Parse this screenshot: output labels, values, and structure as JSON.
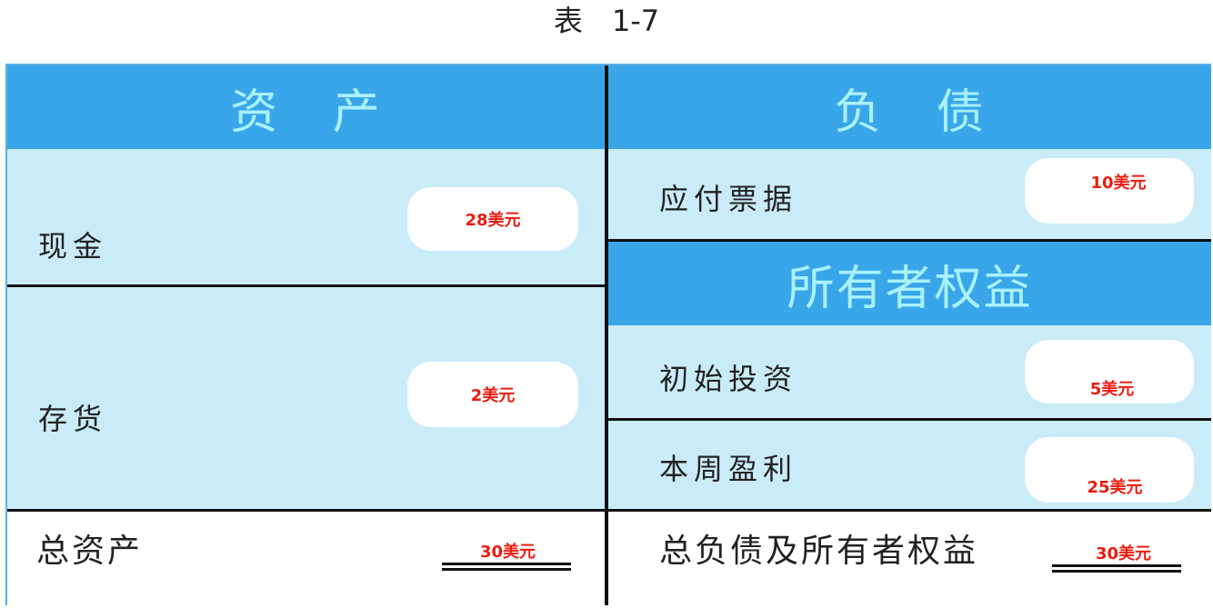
{
  "caption": "表　1-7",
  "assets": {
    "header": "资 产",
    "rows": [
      {
        "label": "现金",
        "amount": "28美元"
      },
      {
        "label": "存货",
        "amount": "2美元"
      }
    ],
    "total_label": "总资产",
    "total_amount": "30美元"
  },
  "liabilities": {
    "header": "负 债",
    "rows": [
      {
        "label": "应付票据",
        "amount": "10美元"
      }
    ]
  },
  "equity": {
    "header": "所有者权益",
    "rows": [
      {
        "label": "初始投资",
        "amount": "5美元"
      },
      {
        "label": "本周盈利",
        "amount": "25美元"
      }
    ]
  },
  "right_total": {
    "label": "总负债及所有者权益",
    "amount": "30美元"
  },
  "colors": {
    "header_blue": "#3aa6ea",
    "row_light_blue": "#caecf9",
    "header_text": "#a9f2fb",
    "amount_red": "#ea1c10"
  }
}
